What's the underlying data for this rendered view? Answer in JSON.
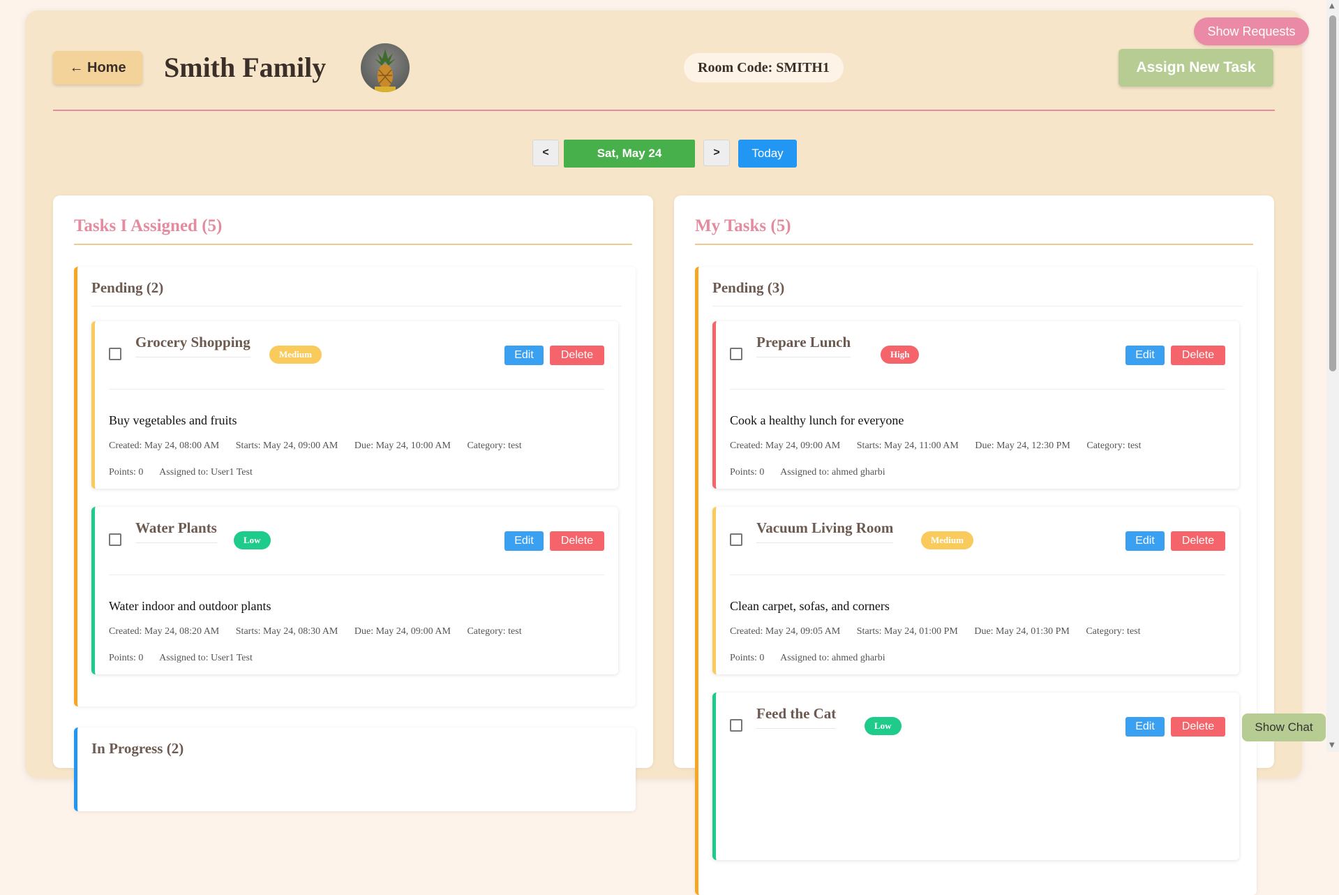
{
  "header": {
    "home_label": "← Home",
    "family_name": "Smith Family",
    "room_code": "Room Code: SMITH1",
    "assign_label": "Assign New Task",
    "show_requests_label": "Show Requests"
  },
  "date_nav": {
    "prev": "<",
    "current": "Sat, May 24",
    "next": ">",
    "today": "Today"
  },
  "colors": {
    "accent_pink": "#e48ba0",
    "pending_border": "#f5a623",
    "medium": "#f9cb5c",
    "high": "#f4646a",
    "low": "#1ecb8b",
    "date_green": "#47b04b",
    "today_blue": "#2196f3"
  },
  "assigned": {
    "title": "Tasks I Assigned (5)",
    "pending_title": "Pending (2)",
    "in_progress_title": "In Progress (2)",
    "tasks": [
      {
        "name": "Grocery Shopping",
        "priority": "Medium",
        "description": "Buy vegetables and fruits",
        "created": "Created: May 24, 08:00 AM",
        "starts": "Starts: May 24, 09:00 AM",
        "due": "Due: May 24, 10:00 AM",
        "category": "Category: test",
        "points": "Points: 0",
        "assigned_to": "Assigned to: User1 Test",
        "edit": "Edit",
        "delete": "Delete"
      },
      {
        "name": "Water Plants",
        "priority": "Low",
        "description": "Water indoor and outdoor plants",
        "created": "Created: May 24, 08:20 AM",
        "starts": "Starts: May 24, 08:30 AM",
        "due": "Due: May 24, 09:00 AM",
        "category": "Category: test",
        "points": "Points: 0",
        "assigned_to": "Assigned to: User1 Test",
        "edit": "Edit",
        "delete": "Delete"
      }
    ]
  },
  "mine": {
    "title": "My Tasks (5)",
    "pending_title": "Pending (3)",
    "tasks": [
      {
        "name": "Prepare Lunch",
        "priority": "High",
        "description": "Cook a healthy lunch for everyone",
        "created": "Created: May 24, 09:00 AM",
        "starts": "Starts: May 24, 11:00 AM",
        "due": "Due: May 24, 12:30 PM",
        "category": "Category: test",
        "points": "Points: 0",
        "assigned_to": "Assigned to: ahmed gharbi",
        "edit": "Edit",
        "delete": "Delete"
      },
      {
        "name": "Vacuum Living Room",
        "priority": "Medium",
        "description": "Clean carpet, sofas, and corners",
        "created": "Created: May 24, 09:05 AM",
        "starts": "Starts: May 24, 01:00 PM",
        "due": "Due: May 24, 01:30 PM",
        "category": "Category: test",
        "points": "Points: 0",
        "assigned_to": "Assigned to: ahmed gharbi",
        "edit": "Edit",
        "delete": "Delete"
      },
      {
        "name": "Feed the Cat",
        "priority": "Low",
        "edit": "Edit",
        "delete": "Delete"
      }
    ]
  },
  "chat": {
    "show_label": "Show Chat"
  }
}
